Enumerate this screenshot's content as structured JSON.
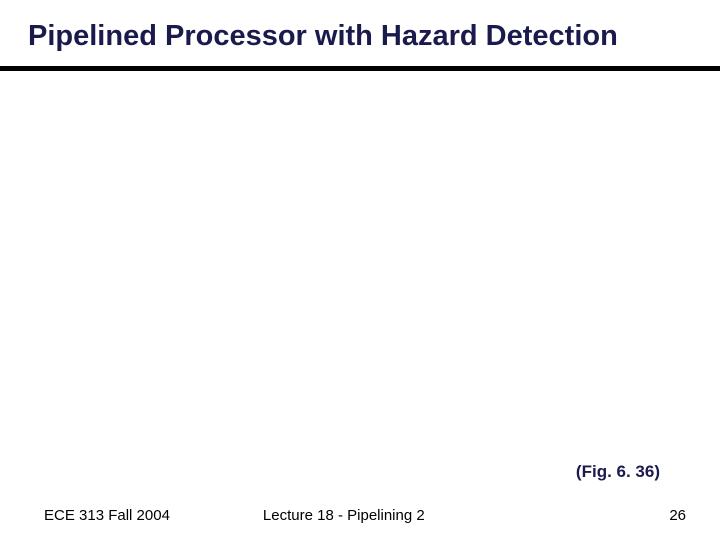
{
  "title": "Pipelined Processor with Hazard Detection",
  "figure_ref": "(Fig. 6. 36)",
  "footer": {
    "left": "ECE 313 Fall 2004",
    "center": "Lecture 18 - Pipelining 2",
    "right": "26"
  }
}
